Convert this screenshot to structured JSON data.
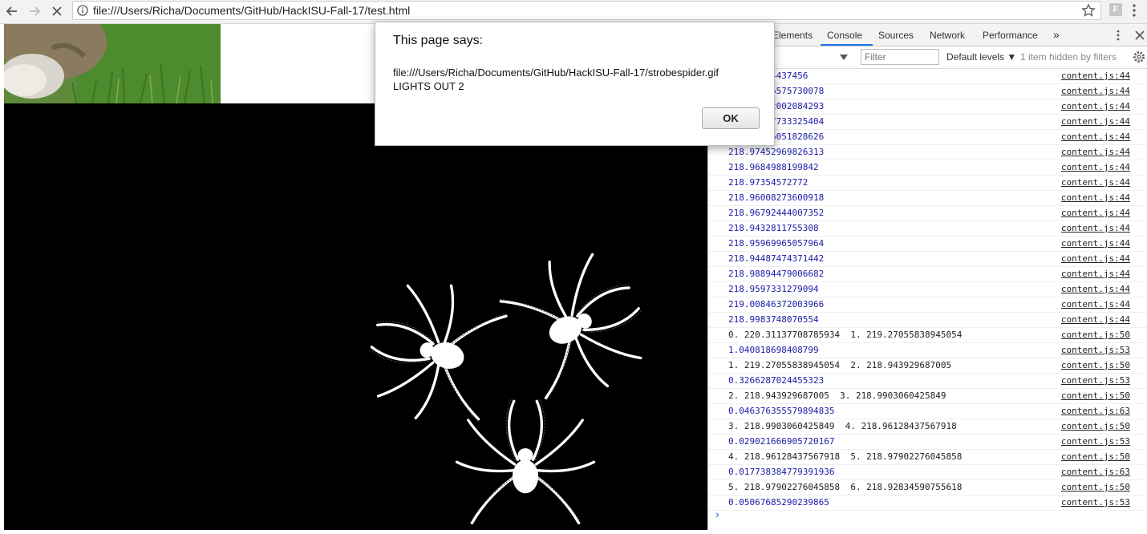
{
  "browser": {
    "url": "file:///Users/Richa/Documents/GitHub/HackISU-Fall-17/test.html",
    "extension_letter": "F"
  },
  "devtools": {
    "tabs": [
      {
        "label": "Elements"
      },
      {
        "label": "Console"
      },
      {
        "label": "Sources"
      },
      {
        "label": "Network"
      },
      {
        "label": "Performance"
      },
      {
        "label": "»"
      }
    ],
    "filter_placeholder": "Filter",
    "levels_label": "Default levels ▼",
    "hidden_label": "1 item hidden by filters",
    "log": [
      {
        "msg": "218.97984437456",
        "src": "content.js:44",
        "kind": "num"
      },
      {
        "msg": "218.97576575730078",
        "src": "content.js:44",
        "kind": "num"
      },
      {
        "msg": "218.96402002084293",
        "src": "content.js:44",
        "kind": "num"
      },
      {
        "msg": "218.96857733325404",
        "src": "content.js:44",
        "kind": "num"
      },
      {
        "msg": "218.97126051828626",
        "src": "content.js:44",
        "kind": "num"
      },
      {
        "msg": "218.97452969826313",
        "src": "content.js:44",
        "kind": "num"
      },
      {
        "msg": "218.9684988199842",
        "src": "content.js:44",
        "kind": "num"
      },
      {
        "msg": "218.97354572772",
        "src": "content.js:44",
        "kind": "num"
      },
      {
        "msg": "218.96008273600918",
        "src": "content.js:44",
        "kind": "num"
      },
      {
        "msg": "218.96792444007352",
        "src": "content.js:44",
        "kind": "num"
      },
      {
        "msg": "218.9432811755308",
        "src": "content.js:44",
        "kind": "num"
      },
      {
        "msg": "218.95969965057964",
        "src": "content.js:44",
        "kind": "num"
      },
      {
        "msg": "218.94487474371442",
        "src": "content.js:44",
        "kind": "num"
      },
      {
        "msg": "218.98894479006682",
        "src": "content.js:44",
        "kind": "num"
      },
      {
        "msg": "218.9597331279094",
        "src": "content.js:44",
        "kind": "num"
      },
      {
        "msg": "219.00846372003966",
        "src": "content.js:44",
        "kind": "num"
      },
      {
        "msg": "218.9983748070554",
        "src": "content.js:44",
        "kind": "num"
      },
      {
        "msg": "0. 220.31137708785934  1. 219.27055838945054",
        "src": "content.js:50",
        "kind": "txt"
      },
      {
        "msg": "1.040818698408799",
        "src": "content.js:53",
        "kind": "num"
      },
      {
        "msg": "1. 219.27055838945054  2. 218.943929687005",
        "src": "content.js:50",
        "kind": "txt"
      },
      {
        "msg": "0.3266287024455323",
        "src": "content.js:53",
        "kind": "num"
      },
      {
        "msg": "2. 218.943929687005  3. 218.9903060425849",
        "src": "content.js:50",
        "kind": "txt"
      },
      {
        "msg": "0.046376355579894835",
        "src": "content.js:63",
        "kind": "num"
      },
      {
        "msg": "3. 218.9903060425849  4. 218.96128437567918",
        "src": "content.js:50",
        "kind": "txt"
      },
      {
        "msg": "0.029021666905720167",
        "src": "content.js:53",
        "kind": "num"
      },
      {
        "msg": "4. 218.96128437567918  5. 218.97902276045858",
        "src": "content.js:50",
        "kind": "txt"
      },
      {
        "msg": "0.017738384779391936",
        "src": "content.js:63",
        "kind": "num"
      },
      {
        "msg": "5. 218.97902276045858  6. 218.92834590755618",
        "src": "content.js:50",
        "kind": "txt"
      },
      {
        "msg": "0.05067685290239865",
        "src": "content.js:53",
        "kind": "num"
      }
    ],
    "prompt_symbol": "›"
  },
  "dialog": {
    "title": "This page says:",
    "message": "file:///Users/Richa/Documents/GitHub/HackISU-Fall-17/strobespider.gif\nLIGHTS OUT 2",
    "ok_label": "OK"
  },
  "colors": {
    "accent": "#1a73e8",
    "log_number": "#1a1aa6"
  }
}
